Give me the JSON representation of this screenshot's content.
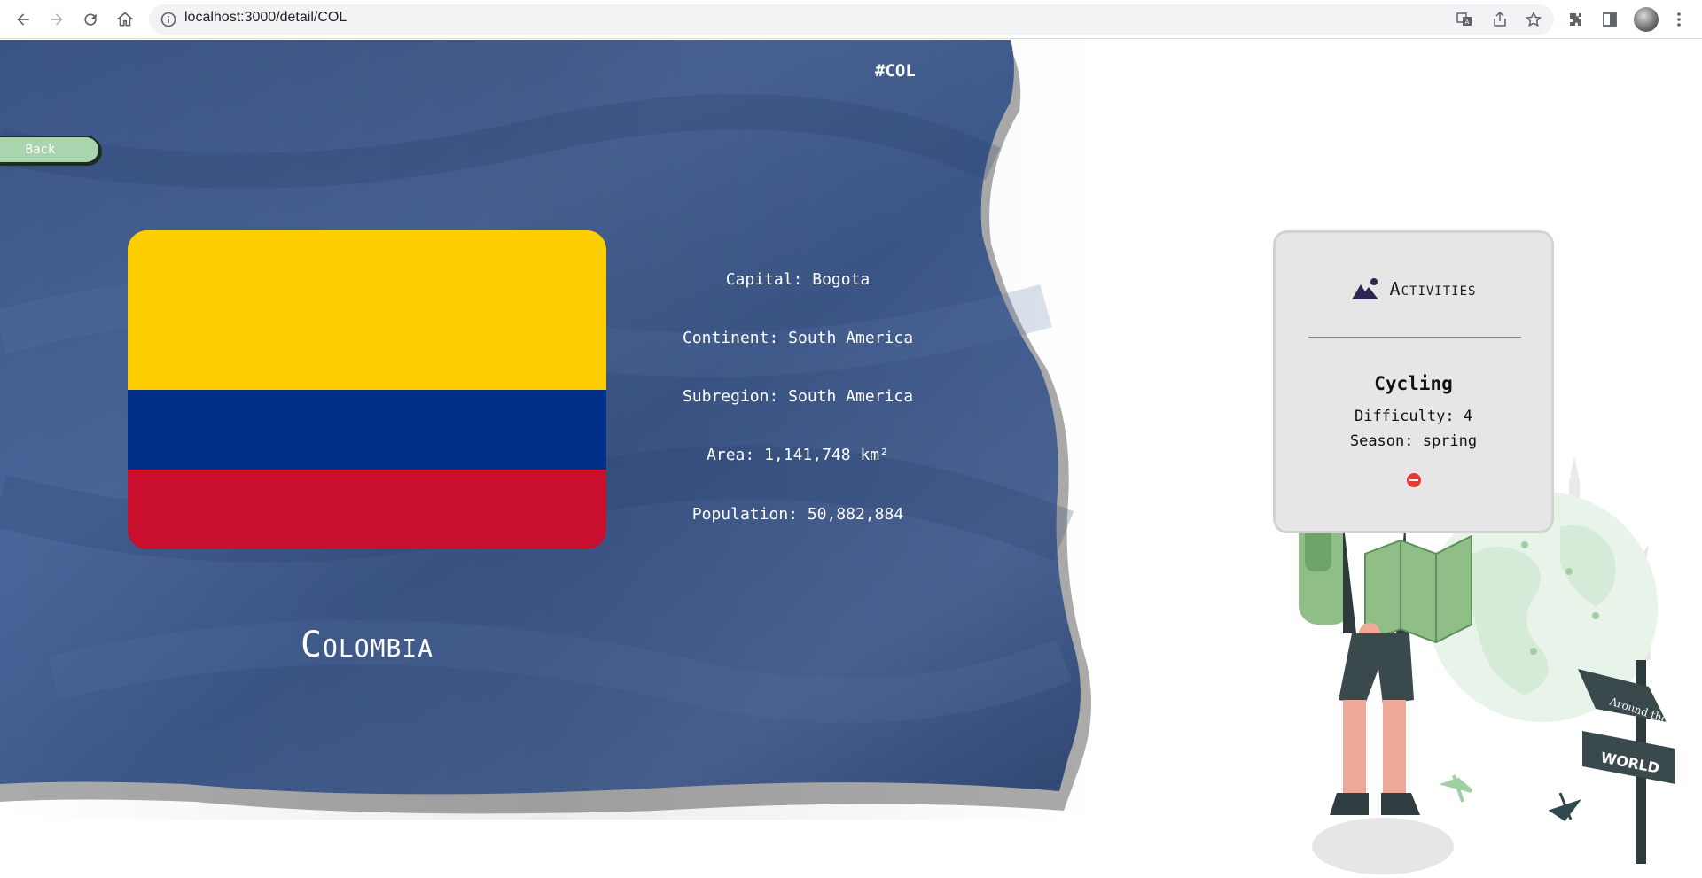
{
  "browser": {
    "url": "localhost:3000/detail/COL"
  },
  "country": {
    "code_tag": "#COL",
    "name": "Colombia",
    "back_label": "Back",
    "flag_colors": [
      "#fdce00",
      "#003087",
      "#c8102e"
    ],
    "info": {
      "capital": "Capital: Bogota",
      "continent": "Continent: South America",
      "subregion": "Subregion: South America",
      "area": "Area: 1,141,748 km²",
      "population": "Population: 50,882,884"
    }
  },
  "activities": {
    "title": "Activities",
    "items": [
      {
        "name": "Cycling",
        "difficulty": "Difficulty: 4",
        "season": "Season: spring"
      }
    ]
  },
  "illustration": {
    "sign_text_1": "Around the",
    "sign_text_2": "WORLD"
  },
  "colors": {
    "flag_background": "#3f5a8f",
    "back_button": "#a8d5ad",
    "card_background": "#e6e6e6",
    "delete": "#e53935"
  }
}
